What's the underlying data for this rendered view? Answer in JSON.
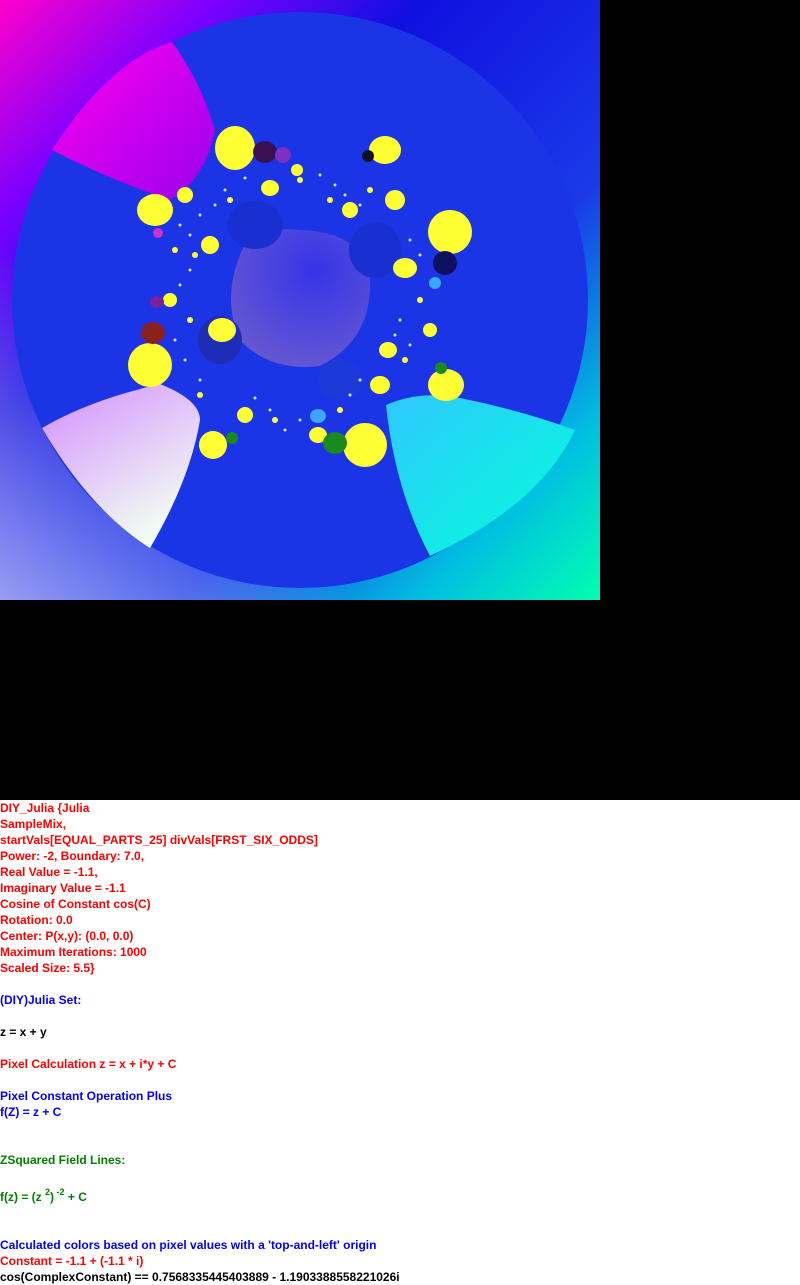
{
  "palette": {
    "background": "#000000",
    "panel": "#ffffff",
    "disk_blue": "#1b35e6",
    "center_blob": "#5b4fd8",
    "bulb_yellow": "#ffff33",
    "red_text": "#ff0000",
    "blue_text": "#0000ff",
    "green_text": "#008000",
    "black_text": "#000000"
  },
  "info": {
    "l1": "DIY_Julia {Julia",
    "l2": "SampleMix,",
    "l3": "startVals[EQUAL_PARTS_25] divVals[FRST_SIX_ODDS]",
    "l4": "Power: -2, Boundary: 7.0,",
    "l5": "Real Value = -1.1,",
    "l6": "Imaginary Value = -1.1",
    "l7": "Cosine of Constant cos(C)",
    "l8": "Rotation: 0.0",
    "l9": "Center: P(x,y): (0.0, 0.0)",
    "l10": "Maximum Iterations: 1000",
    "l11": "Scaled Size: 5.5}",
    "set_title": "(DIY)Julia Set:",
    "z_def": "z = x + y",
    "pixel_calc": "Pixel Calculation z = x + i*y + C",
    "const_op": "Pixel Constant Operation Plus",
    "fz": "f(Z) = z + C",
    "field_title": "ZSquared Field Lines:",
    "formula": {
      "a": "f(z) = (z ",
      "b": "2",
      "c": ")",
      "d": " -2",
      "e": " + C"
    },
    "colors_note": "Calculated colors based on pixel values with a 'top-and-left' origin",
    "constant": "Constant = -1.1 + (-1.1 * i)",
    "cos_const": "cos(ComplexConstant) == 0.7568335445403889 - 1.1903388558221026i"
  }
}
